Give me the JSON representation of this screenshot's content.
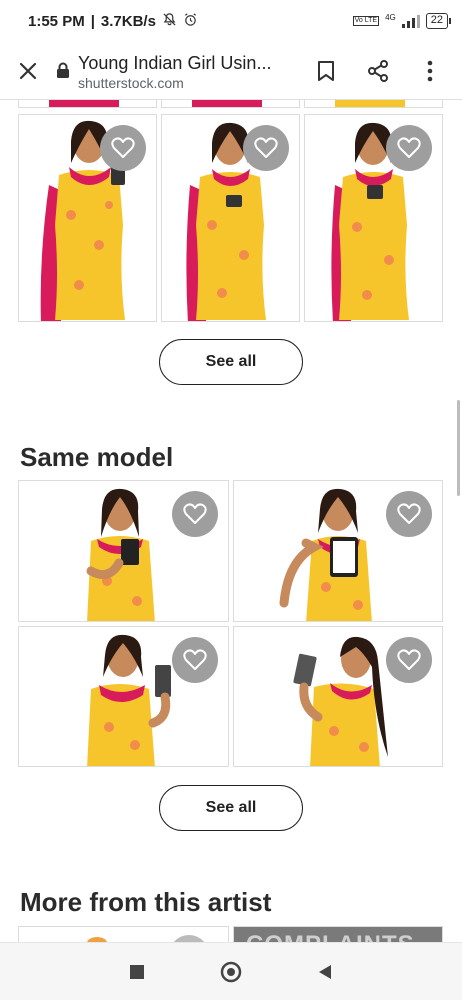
{
  "status_bar": {
    "time": "1:55 PM",
    "speed": "3.7KB/s",
    "volte": "Vo LTE",
    "network": "4G",
    "battery": "22"
  },
  "toolbar": {
    "title": "Young Indian Girl Usin...",
    "url": "shutterstock.com"
  },
  "sections": {
    "top_see_all": "See all",
    "same_model": {
      "title": "Same model",
      "see_all": "See all"
    },
    "more_from_artist": {
      "title": "More from this artist",
      "partial_text": "COMPLAINTS"
    }
  },
  "colors": {
    "dress_yellow": "#f6c52b",
    "dupatta_pink": "#d81b5a",
    "heart_bg": "#9e9e9e"
  }
}
